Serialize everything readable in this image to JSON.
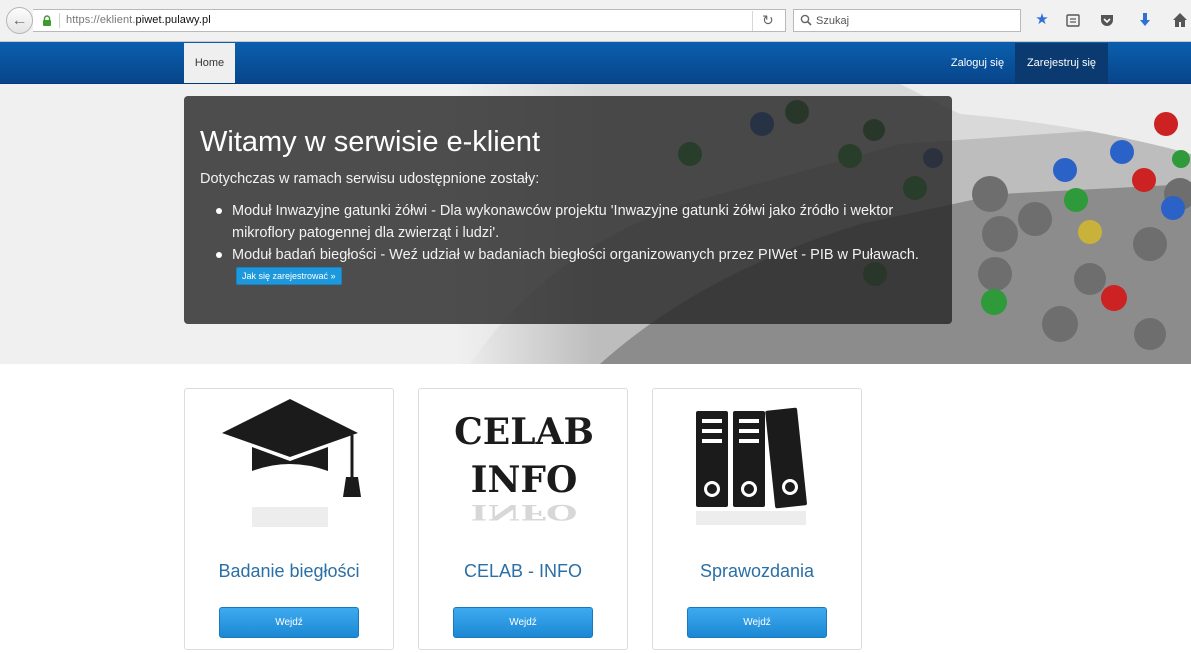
{
  "browser": {
    "url_prefix": "https://eklient.",
    "url_domain": "piwet.pulawy.pl",
    "search_placeholder": "Szukaj"
  },
  "nav": {
    "home": "Home",
    "login": "Zaloguj się",
    "register": "Zarejestruj się"
  },
  "hero": {
    "title": "Witamy w serwisie e-klient",
    "lead": "Dotychczas w ramach serwisu udostępnione zostały:",
    "items": [
      "Moduł Inwazyjne gatunki żółwi - Dla wykonawców projektu 'Inwazyjne gatunki żółwi jako źródło i wektor mikroflory patogennej dla zwierząt i ludzi'.",
      "Moduł badań biegłości - Weź udział w badaniach biegłości organizowanych przez PIWet - PIB w Puławach."
    ],
    "register_info_button": "Jak się zarejestrować »"
  },
  "cards": [
    {
      "title": "Badanie biegłości",
      "button": "Wejdź",
      "icon": "graduation-cap-icon"
    },
    {
      "title": "CELAB - INFO",
      "button": "Wejdź",
      "icon": "celab-info-logo",
      "logo_lines": [
        "CELAB",
        "INFO"
      ]
    },
    {
      "title": "Sprawozdania",
      "button": "Wejdź",
      "icon": "binders-icon"
    }
  ],
  "colors": {
    "navbar": "#0a56a3",
    "link_title": "#2a6fa6",
    "button": "#1e98dc"
  }
}
